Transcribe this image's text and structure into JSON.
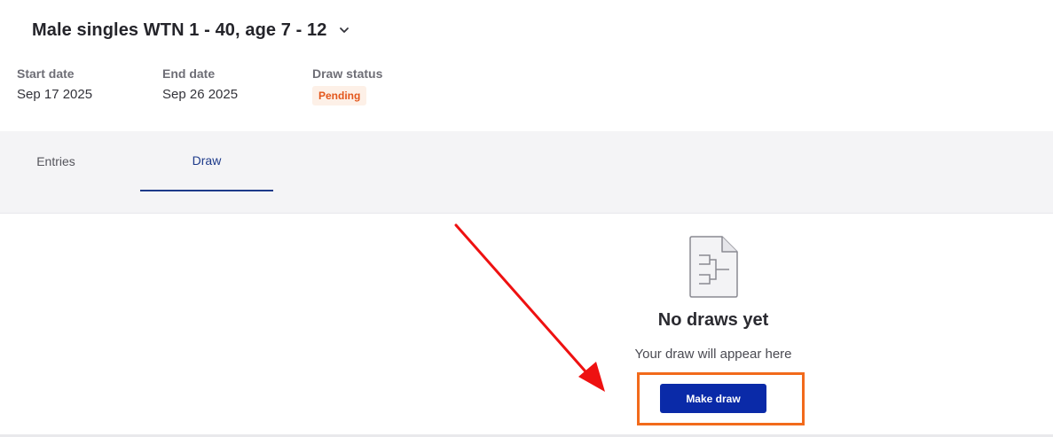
{
  "event": {
    "title": "Male singles WTN 1 - 40, age 7 - 12",
    "chevron_icon": "chevron-down-icon"
  },
  "meta": {
    "start_label": "Start date",
    "start_value": "Sep 17 2025",
    "end_label": "End date",
    "end_value": "Sep 26 2025",
    "status_label": "Draw status",
    "status_value": "Pending"
  },
  "tabs": [
    {
      "label": "Entries",
      "active": false
    },
    {
      "label": "Draw",
      "active": true
    }
  ],
  "empty_state": {
    "icon": "bracket-document-icon",
    "title": "No draws yet",
    "subtitle": "Your draw will appear here",
    "button_label": "Make draw"
  },
  "colors": {
    "accent": "#1d3a8a",
    "button": "#0a2aa8",
    "badge_text": "#e3561b",
    "badge_bg": "#fdf0e7",
    "annotation_box": "#f26a1b",
    "annotation_arrow": "#ee1111"
  }
}
